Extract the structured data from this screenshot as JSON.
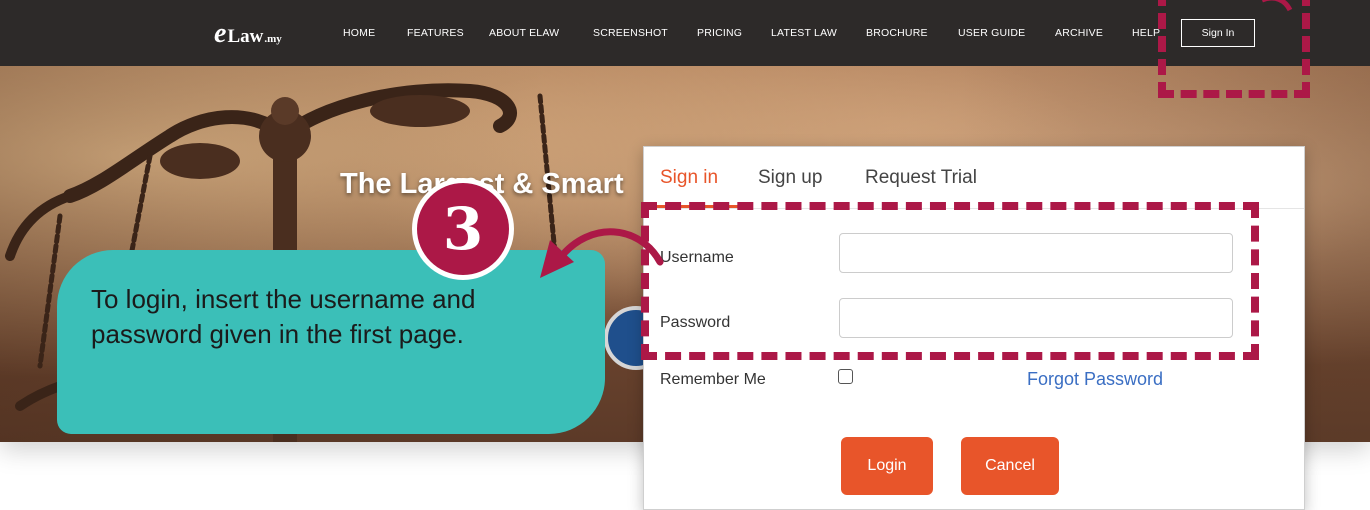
{
  "brand": {
    "logo_mark": "e",
    "logo_main": "Law",
    "logo_suffix": ".my"
  },
  "nav": {
    "items": [
      "HOME",
      "FEATURES",
      "ABOUT ELAW",
      "SCREENSHOT",
      "PRICING",
      "LATEST LAW",
      "BROCHURE",
      "USER GUIDE",
      "ARCHIVE",
      "HELP"
    ],
    "sign_in": "Sign In"
  },
  "hero": {
    "title": "The Largest & Smart"
  },
  "login": {
    "tabs": [
      "Sign in",
      "Sign up",
      "Request Trial"
    ],
    "username_label": "Username",
    "password_label": "Password",
    "remember_label": "Remember Me",
    "forgot_label": "Forgot Password",
    "login_button": "Login",
    "cancel_button": "Cancel"
  },
  "annotation": {
    "step_number": "3",
    "tip_text": "To login, insert the username and password given in the first page."
  },
  "colors": {
    "accent": "#e8552a",
    "highlight": "#ac1847",
    "tip_bg": "#3bbfb8",
    "link": "#3a6ec3",
    "navbar": "#2d2a29"
  }
}
